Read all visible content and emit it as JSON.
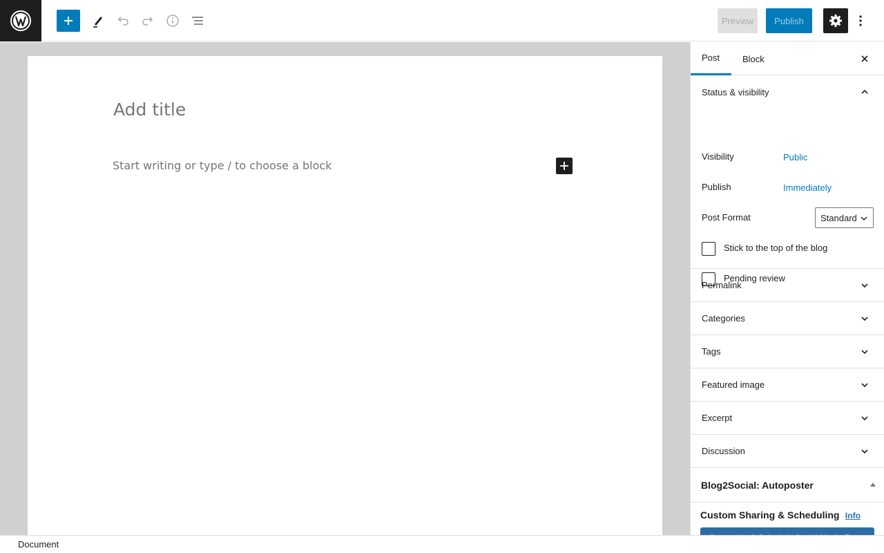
{
  "toolbar": {
    "preview_label": "Preview",
    "publish_label": "Publish"
  },
  "editor": {
    "title_placeholder": "Add title",
    "body_placeholder": "Start writing or type / to choose a block"
  },
  "sidebar": {
    "tabs": [
      {
        "label": "Post",
        "active": true
      },
      {
        "label": "Block",
        "active": false
      }
    ],
    "status_visibility": {
      "title": "Status & visibility",
      "visibility_label": "Visibility",
      "visibility_value": "Public",
      "publish_label": "Publish",
      "publish_value": "Immediately",
      "post_format_label": "Post Format",
      "post_format_value": "Standard",
      "stick_label": "Stick to the top of the blog",
      "pending_label": "Pending review"
    },
    "panels": [
      {
        "label": "Permalink"
      },
      {
        "label": "Categories"
      },
      {
        "label": "Tags"
      },
      {
        "label": "Featured image"
      },
      {
        "label": "Excerpt"
      },
      {
        "label": "Discussion"
      }
    ],
    "b2s": {
      "title": "Blog2Social: Autoposter",
      "section_title": "Custom Sharing & Scheduling",
      "info_link": "Info",
      "button_label": "Customize & Schedule Social Media Posts"
    }
  },
  "footer": {
    "breadcrumb": "Document"
  },
  "colors": {
    "accent": "#007cba",
    "dark": "#1e1e1e"
  }
}
